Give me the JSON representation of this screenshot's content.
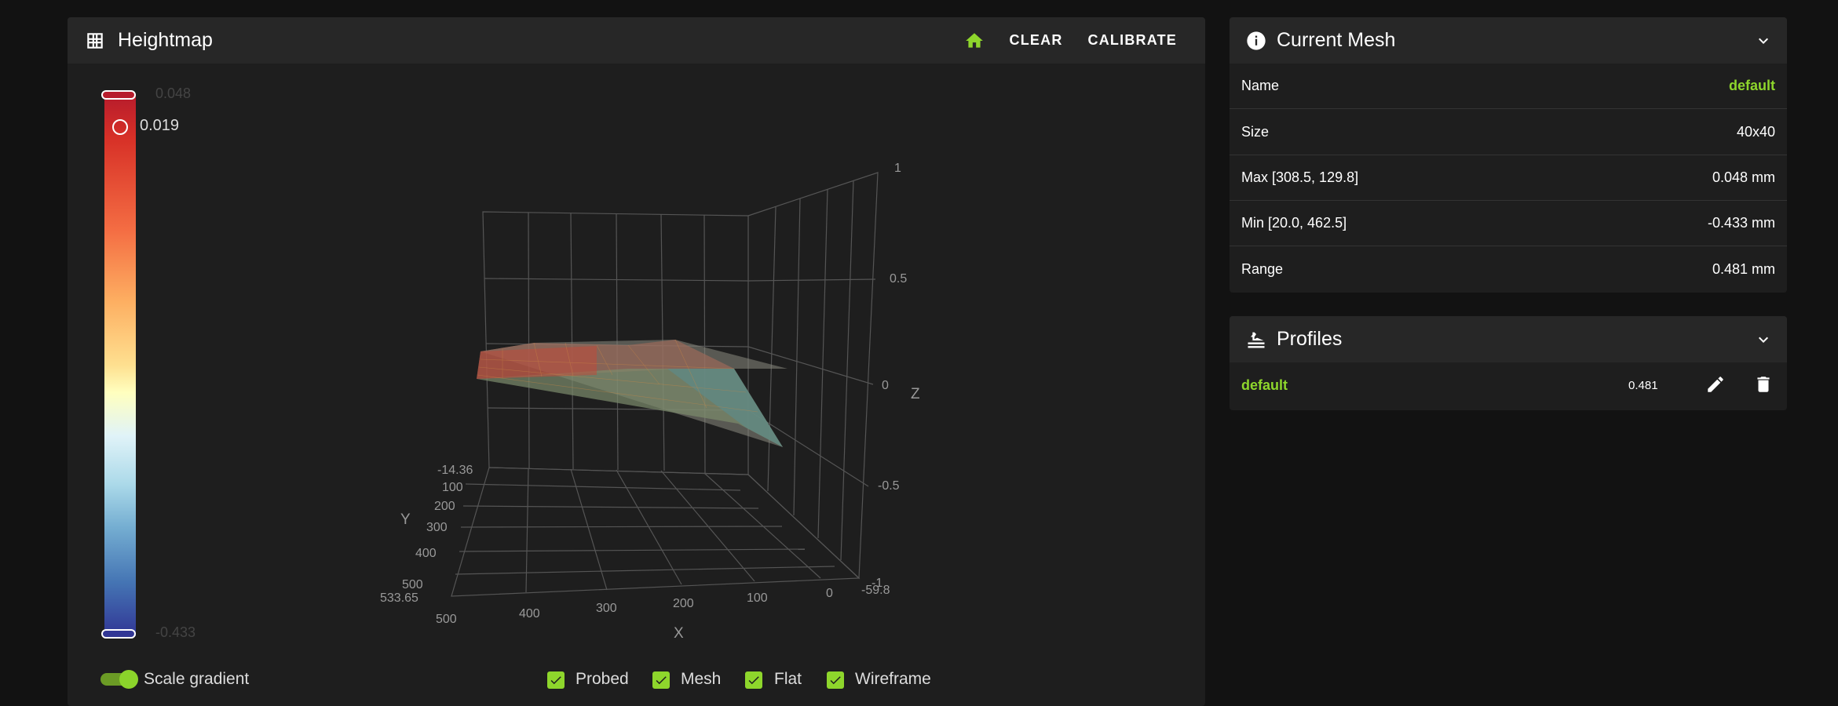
{
  "heightmap": {
    "title": "Heightmap",
    "actions": {
      "clear": "CLEAR",
      "calibrate": "CALIBRATE"
    },
    "scale": {
      "max": "0.048",
      "current": "0.019",
      "min": "-0.433"
    },
    "axes": {
      "x_label": "X",
      "y_label": "Y",
      "z_label": "Z",
      "x_ticks": [
        "500",
        "400",
        "300",
        "200",
        "100",
        "0"
      ],
      "x_end": "-59.8",
      "y_ticks": [
        "100",
        "200",
        "300",
        "400",
        "500"
      ],
      "y_start": "-14.36",
      "y_end": "533.65",
      "z_ticks": [
        "1",
        "0.5",
        "0",
        "-0.5",
        "-1"
      ]
    },
    "scale_gradient_label": "Scale gradient",
    "options": [
      {
        "label": "Probed",
        "checked": true
      },
      {
        "label": "Mesh",
        "checked": true
      },
      {
        "label": "Flat",
        "checked": true
      },
      {
        "label": "Wireframe",
        "checked": true
      }
    ]
  },
  "current_mesh": {
    "title": "Current Mesh",
    "rows": [
      {
        "label": "Name",
        "value": "default"
      },
      {
        "label": "Size",
        "value": "40x40"
      },
      {
        "label": "Max [308.5, 129.8]",
        "value": "0.048 mm"
      },
      {
        "label": "Min [20.0, 462.5]",
        "value": "-0.433 mm"
      },
      {
        "label": "Range",
        "value": "0.481 mm"
      }
    ]
  },
  "profiles": {
    "title": "Profiles",
    "items": [
      {
        "name": "default",
        "range": "0.481"
      }
    ]
  },
  "colors": {
    "accent": "#8ed62c",
    "card": "#1e1e1e",
    "header": "#272727",
    "background": "#121212"
  },
  "icons": {
    "heightmap": "grid-icon",
    "home": "home-icon",
    "mesh": "info-icon",
    "profiles": "layers-icon",
    "collapse": "chevron-down-icon",
    "edit": "pencil-icon",
    "delete": "trash-icon"
  }
}
